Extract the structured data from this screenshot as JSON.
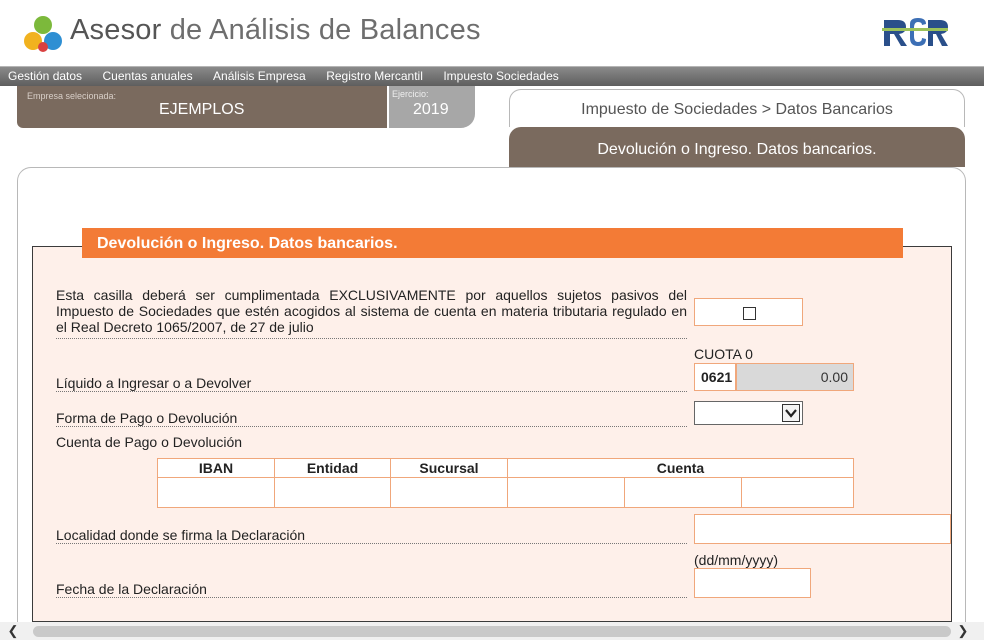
{
  "app": {
    "title_part1": "Asesor",
    "title_part2": " de Análisis de Balances"
  },
  "menu": [
    "Gestión datos",
    "Cuentas anuales",
    "Análisis Empresa",
    "Registro Mercantil",
    "Impuesto Sociedades"
  ],
  "company": {
    "label": "Empresa selecionada:",
    "value": "EJEMPLOS"
  },
  "year": {
    "label": "Ejercicio:",
    "value": "2019"
  },
  "breadcrumb": "Impuesto de Sociedades > Datos Bancarios",
  "section_tab": "Devolución o Ingreso. Datos bancarios.",
  "form": {
    "title": "Devolución o Ingreso. Datos bancarios.",
    "exclusive_text": "Esta casilla deberá ser cumplimentada EXCLUSIVAMENTE por aquellos sujetos pasivos del Impuesto de Sociedades que estén acogidos al sistema de cuenta en materia tributaria regulado en el Real Decreto 1065/2007, de 27 de julio",
    "cuota_label": "CUOTA 0",
    "liquido_label": "Líquido a Ingresar o a Devolver",
    "box_code": "0621",
    "amount": "0.00",
    "forma_label": "Forma de Pago o Devolución",
    "forma_value": "",
    "cuenta_label": "Cuenta de Pago o Devolución",
    "account_headers": [
      "IBAN",
      "Entidad",
      "Sucursal",
      "Cuenta"
    ],
    "localidad_label": "Localidad donde se firma la Declaración",
    "date_format": "(dd/mm/yyyy)",
    "fecha_label": "Fecha de la Declaración"
  },
  "icons": {
    "logo": "brand-logo-icon",
    "checkbox": "checkbox-icon",
    "dropdown": "chevron-down-icon"
  }
}
